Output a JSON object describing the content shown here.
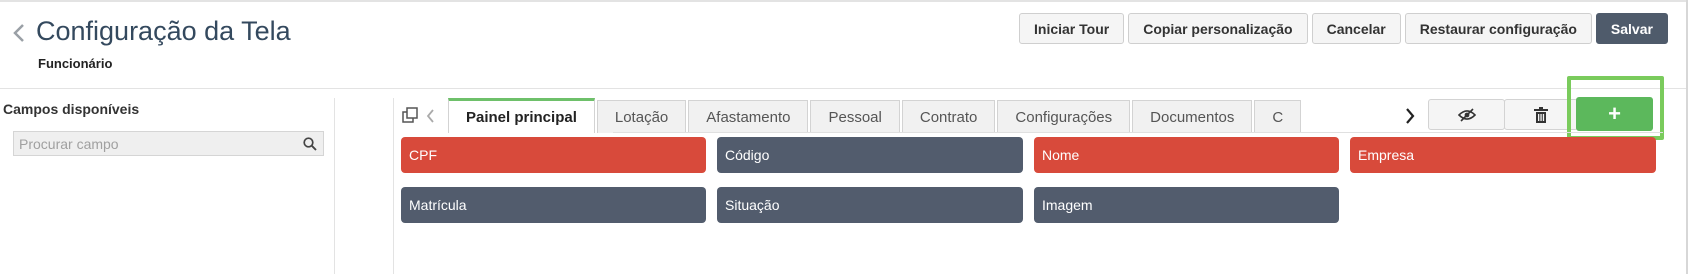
{
  "header": {
    "title": "Configuração da Tela",
    "subtitle": "Funcionário",
    "buttons": {
      "tour": "Iniciar Tour",
      "copy": "Copiar personalização",
      "cancel": "Cancelar",
      "restore": "Restaurar configuração",
      "save": "Salvar"
    }
  },
  "sidebar": {
    "title": "Campos disponíveis",
    "search_placeholder": "Procurar campo"
  },
  "tabs": [
    {
      "label": "Painel principal",
      "active": true
    },
    {
      "label": "Lotação",
      "active": false
    },
    {
      "label": "Afastamento",
      "active": false
    },
    {
      "label": "Pessoal",
      "active": false
    },
    {
      "label": "Contrato",
      "active": false
    },
    {
      "label": "Configurações",
      "active": false
    },
    {
      "label": "Documentos",
      "active": false
    },
    {
      "label": "C",
      "active": false
    }
  ],
  "fields": [
    {
      "label": "CPF",
      "color": "red"
    },
    {
      "label": "Código",
      "color": "slate"
    },
    {
      "label": "Nome",
      "color": "red"
    },
    {
      "label": "Empresa",
      "color": "red"
    },
    {
      "label": "Matrícula",
      "color": "slate"
    },
    {
      "label": "Situação",
      "color": "slate"
    },
    {
      "label": "Imagem",
      "color": "slate"
    }
  ],
  "toolbar": {
    "add_label": "+",
    "icons": [
      "copy-icon",
      "chevron-left-icon",
      "chevron-right-icon",
      "eye-slash-icon",
      "trash-icon",
      "search-icon"
    ]
  },
  "colors": {
    "required": "#d84a3b",
    "normal": "#525c6d",
    "accent": "#5cb85c",
    "primary_button": "#4f5b6b"
  }
}
